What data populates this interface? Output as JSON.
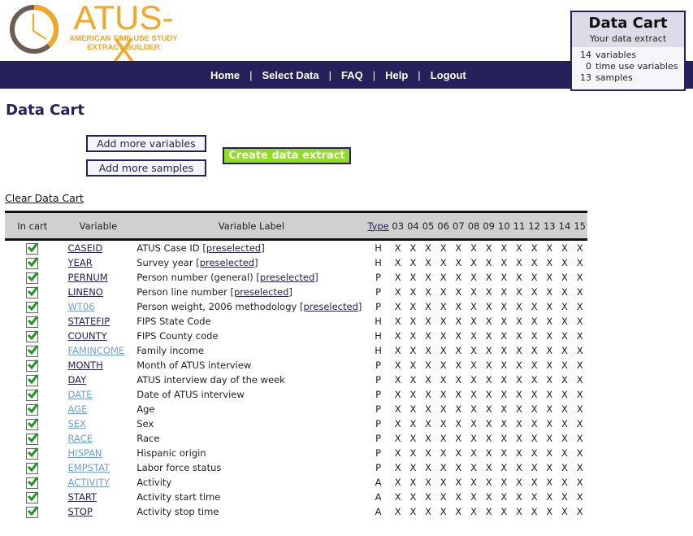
{
  "brand": {
    "title": "ATUS-X",
    "sub1": "AMERICAN TIME USE STUDY",
    "sub2": "EXTRACT BUILDER"
  },
  "nav": [
    "Home",
    "Select Data",
    "FAQ",
    "Help",
    "Logout"
  ],
  "cart": {
    "title": "Data Cart",
    "subtitle": "Your data extract",
    "rows": [
      {
        "n": "14",
        "label": "variables"
      },
      {
        "n": "0",
        "label": "time use variables"
      },
      {
        "n": "13",
        "label": "samples"
      }
    ]
  },
  "page_title": "Data Cart",
  "buttons": {
    "add_vars": "Add more variables",
    "add_samples": "Add more samples",
    "create": "Create data extract",
    "clear": "Clear Data Cart"
  },
  "table": {
    "headers": {
      "in_cart": "In cart",
      "variable": "Variable",
      "label": "Variable Label",
      "type": "Type"
    },
    "years": [
      "03",
      "04",
      "05",
      "06",
      "07",
      "08",
      "09",
      "10",
      "11",
      "12",
      "13",
      "14",
      "15"
    ],
    "preselected": "[preselected]",
    "rows": [
      {
        "var": "CASEID",
        "label": "ATUS Case ID",
        "pre": true,
        "type": "H",
        "visited": false
      },
      {
        "var": "YEAR",
        "label": "Survey year",
        "pre": true,
        "type": "H",
        "visited": false
      },
      {
        "var": "PERNUM",
        "label": "Person number (general)",
        "pre": true,
        "type": "P",
        "visited": false
      },
      {
        "var": "LINENO",
        "label": "Person line number",
        "pre": true,
        "type": "P",
        "visited": false
      },
      {
        "var": "WT06",
        "label": "Person weight, 2006 methodology",
        "pre": true,
        "type": "P",
        "visited": true
      },
      {
        "var": "STATEFIP",
        "label": "FIPS State Code",
        "pre": false,
        "type": "H",
        "visited": false
      },
      {
        "var": "COUNTY",
        "label": "FIPS County code",
        "pre": false,
        "type": "H",
        "visited": false
      },
      {
        "var": "FAMINCOME",
        "label": "Family income",
        "pre": false,
        "type": "H",
        "visited": true
      },
      {
        "var": "MONTH",
        "label": "Month of ATUS interview",
        "pre": false,
        "type": "P",
        "visited": false
      },
      {
        "var": "DAY",
        "label": "ATUS interview day of the week",
        "pre": false,
        "type": "P",
        "visited": false
      },
      {
        "var": "DATE",
        "label": "Date of ATUS interview",
        "pre": false,
        "type": "P",
        "visited": true
      },
      {
        "var": "AGE",
        "label": "Age",
        "pre": false,
        "type": "P",
        "visited": true
      },
      {
        "var": "SEX",
        "label": "Sex",
        "pre": false,
        "type": "P",
        "visited": true
      },
      {
        "var": "RACE",
        "label": "Race",
        "pre": false,
        "type": "P",
        "visited": true
      },
      {
        "var": "HISPAN",
        "label": "Hispanic origin",
        "pre": false,
        "type": "P",
        "visited": true
      },
      {
        "var": "EMPSTAT",
        "label": "Labor force status",
        "pre": false,
        "type": "P",
        "visited": true
      },
      {
        "var": "ACTIVITY",
        "label": "Activity",
        "pre": false,
        "type": "A",
        "visited": true
      },
      {
        "var": "START",
        "label": "Activity start time",
        "pre": false,
        "type": "A",
        "visited": false
      },
      {
        "var": "STOP",
        "label": "Activity stop time",
        "pre": false,
        "type": "A",
        "visited": false
      }
    ],
    "mark": "X"
  },
  "colors": {
    "navy": "#24215b",
    "orange": "#f5a623",
    "green": "#8fe01a",
    "visited": "#6f9fd8"
  }
}
